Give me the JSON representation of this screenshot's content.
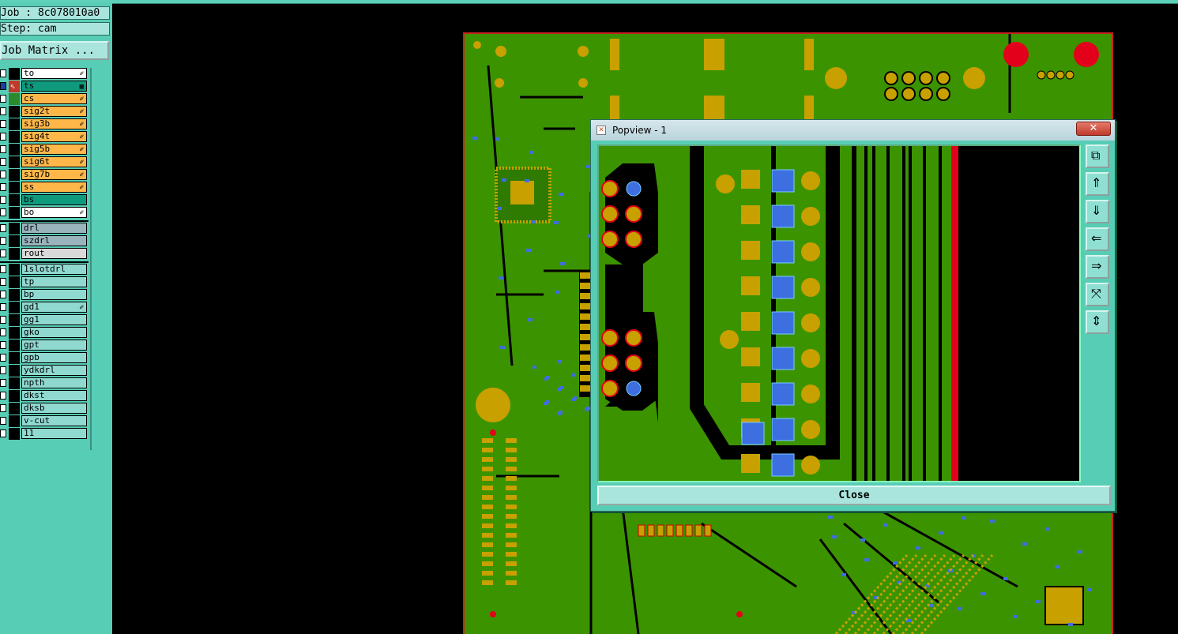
{
  "job_label": "Job : 8c078010a0",
  "step_label": "Step: cam",
  "job_matrix_button": "Job Matrix ...",
  "layers": [
    {
      "name": "to",
      "color": "#ffffff",
      "mark": "✐"
    },
    {
      "name": "ts",
      "color": "#0f9a7d",
      "mark": "▦",
      "active": true
    },
    {
      "name": "cs",
      "color": "#ffb74a",
      "mark": "✐"
    },
    {
      "name": "sig2t",
      "color": "#ffb74a",
      "mark": "✐"
    },
    {
      "name": "sig3b",
      "color": "#ffb74a",
      "mark": "✐"
    },
    {
      "name": "sig4t",
      "color": "#ffb74a",
      "mark": "✐"
    },
    {
      "name": "sig5b",
      "color": "#ffb74a",
      "mark": "✐"
    },
    {
      "name": "sig6t",
      "color": "#ffb74a",
      "mark": "✐"
    },
    {
      "name": "sig7b",
      "color": "#ffb74a",
      "mark": "✐"
    },
    {
      "name": "ss",
      "color": "#ffb74a",
      "mark": "✐"
    },
    {
      "name": "bs",
      "color": "#0f9a7d",
      "mark": ""
    },
    {
      "name": "bo",
      "color": "#ffffff",
      "mark": "✐"
    },
    {
      "name": "drl",
      "color": "#9ab4be",
      "mark": ""
    },
    {
      "name": "szdrl",
      "color": "#9ab4be",
      "mark": ""
    },
    {
      "name": "rout",
      "color": "#d9d9d9",
      "mark": ""
    },
    {
      "name": "1slotdrl",
      "color": "#8fd9d0",
      "mark": ""
    },
    {
      "name": "tp",
      "color": "#8fd9d0",
      "mark": ""
    },
    {
      "name": "bp",
      "color": "#8fd9d0",
      "mark": ""
    },
    {
      "name": "gd1",
      "color": "#8fd9d0",
      "mark": "✐"
    },
    {
      "name": "gg1",
      "color": "#8fd9d0",
      "mark": ""
    },
    {
      "name": "gko",
      "color": "#8fd9d0",
      "mark": ""
    },
    {
      "name": "gpt",
      "color": "#8fd9d0",
      "mark": ""
    },
    {
      "name": "gpb",
      "color": "#8fd9d0",
      "mark": ""
    },
    {
      "name": "ydkdrl",
      "color": "#8fd9d0",
      "mark": ""
    },
    {
      "name": "npth",
      "color": "#8fd9d0",
      "mark": ""
    },
    {
      "name": "dkst",
      "color": "#8fd9d0",
      "mark": ""
    },
    {
      "name": "dksb",
      "color": "#8fd9d0",
      "mark": ""
    },
    {
      "name": "v-cut",
      "color": "#8fd9d0",
      "mark": ""
    },
    {
      "name": "11",
      "color": "#8fd9d0",
      "mark": ""
    }
  ],
  "popview": {
    "title": "Popview - 1",
    "close_x": "✕",
    "close_button": "Close",
    "toolbar_icons": [
      "zoom-window-icon",
      "pan-up-icon",
      "pan-down-icon",
      "pan-left-icon",
      "pan-right-icon",
      "zoom-fit-icon",
      "zoom-home-icon"
    ]
  },
  "colors": {
    "board_green": "#3c9300",
    "pad_gold": "#c8a000",
    "pad_blue": "#3d6fe0",
    "board_outline": "#c92020"
  }
}
